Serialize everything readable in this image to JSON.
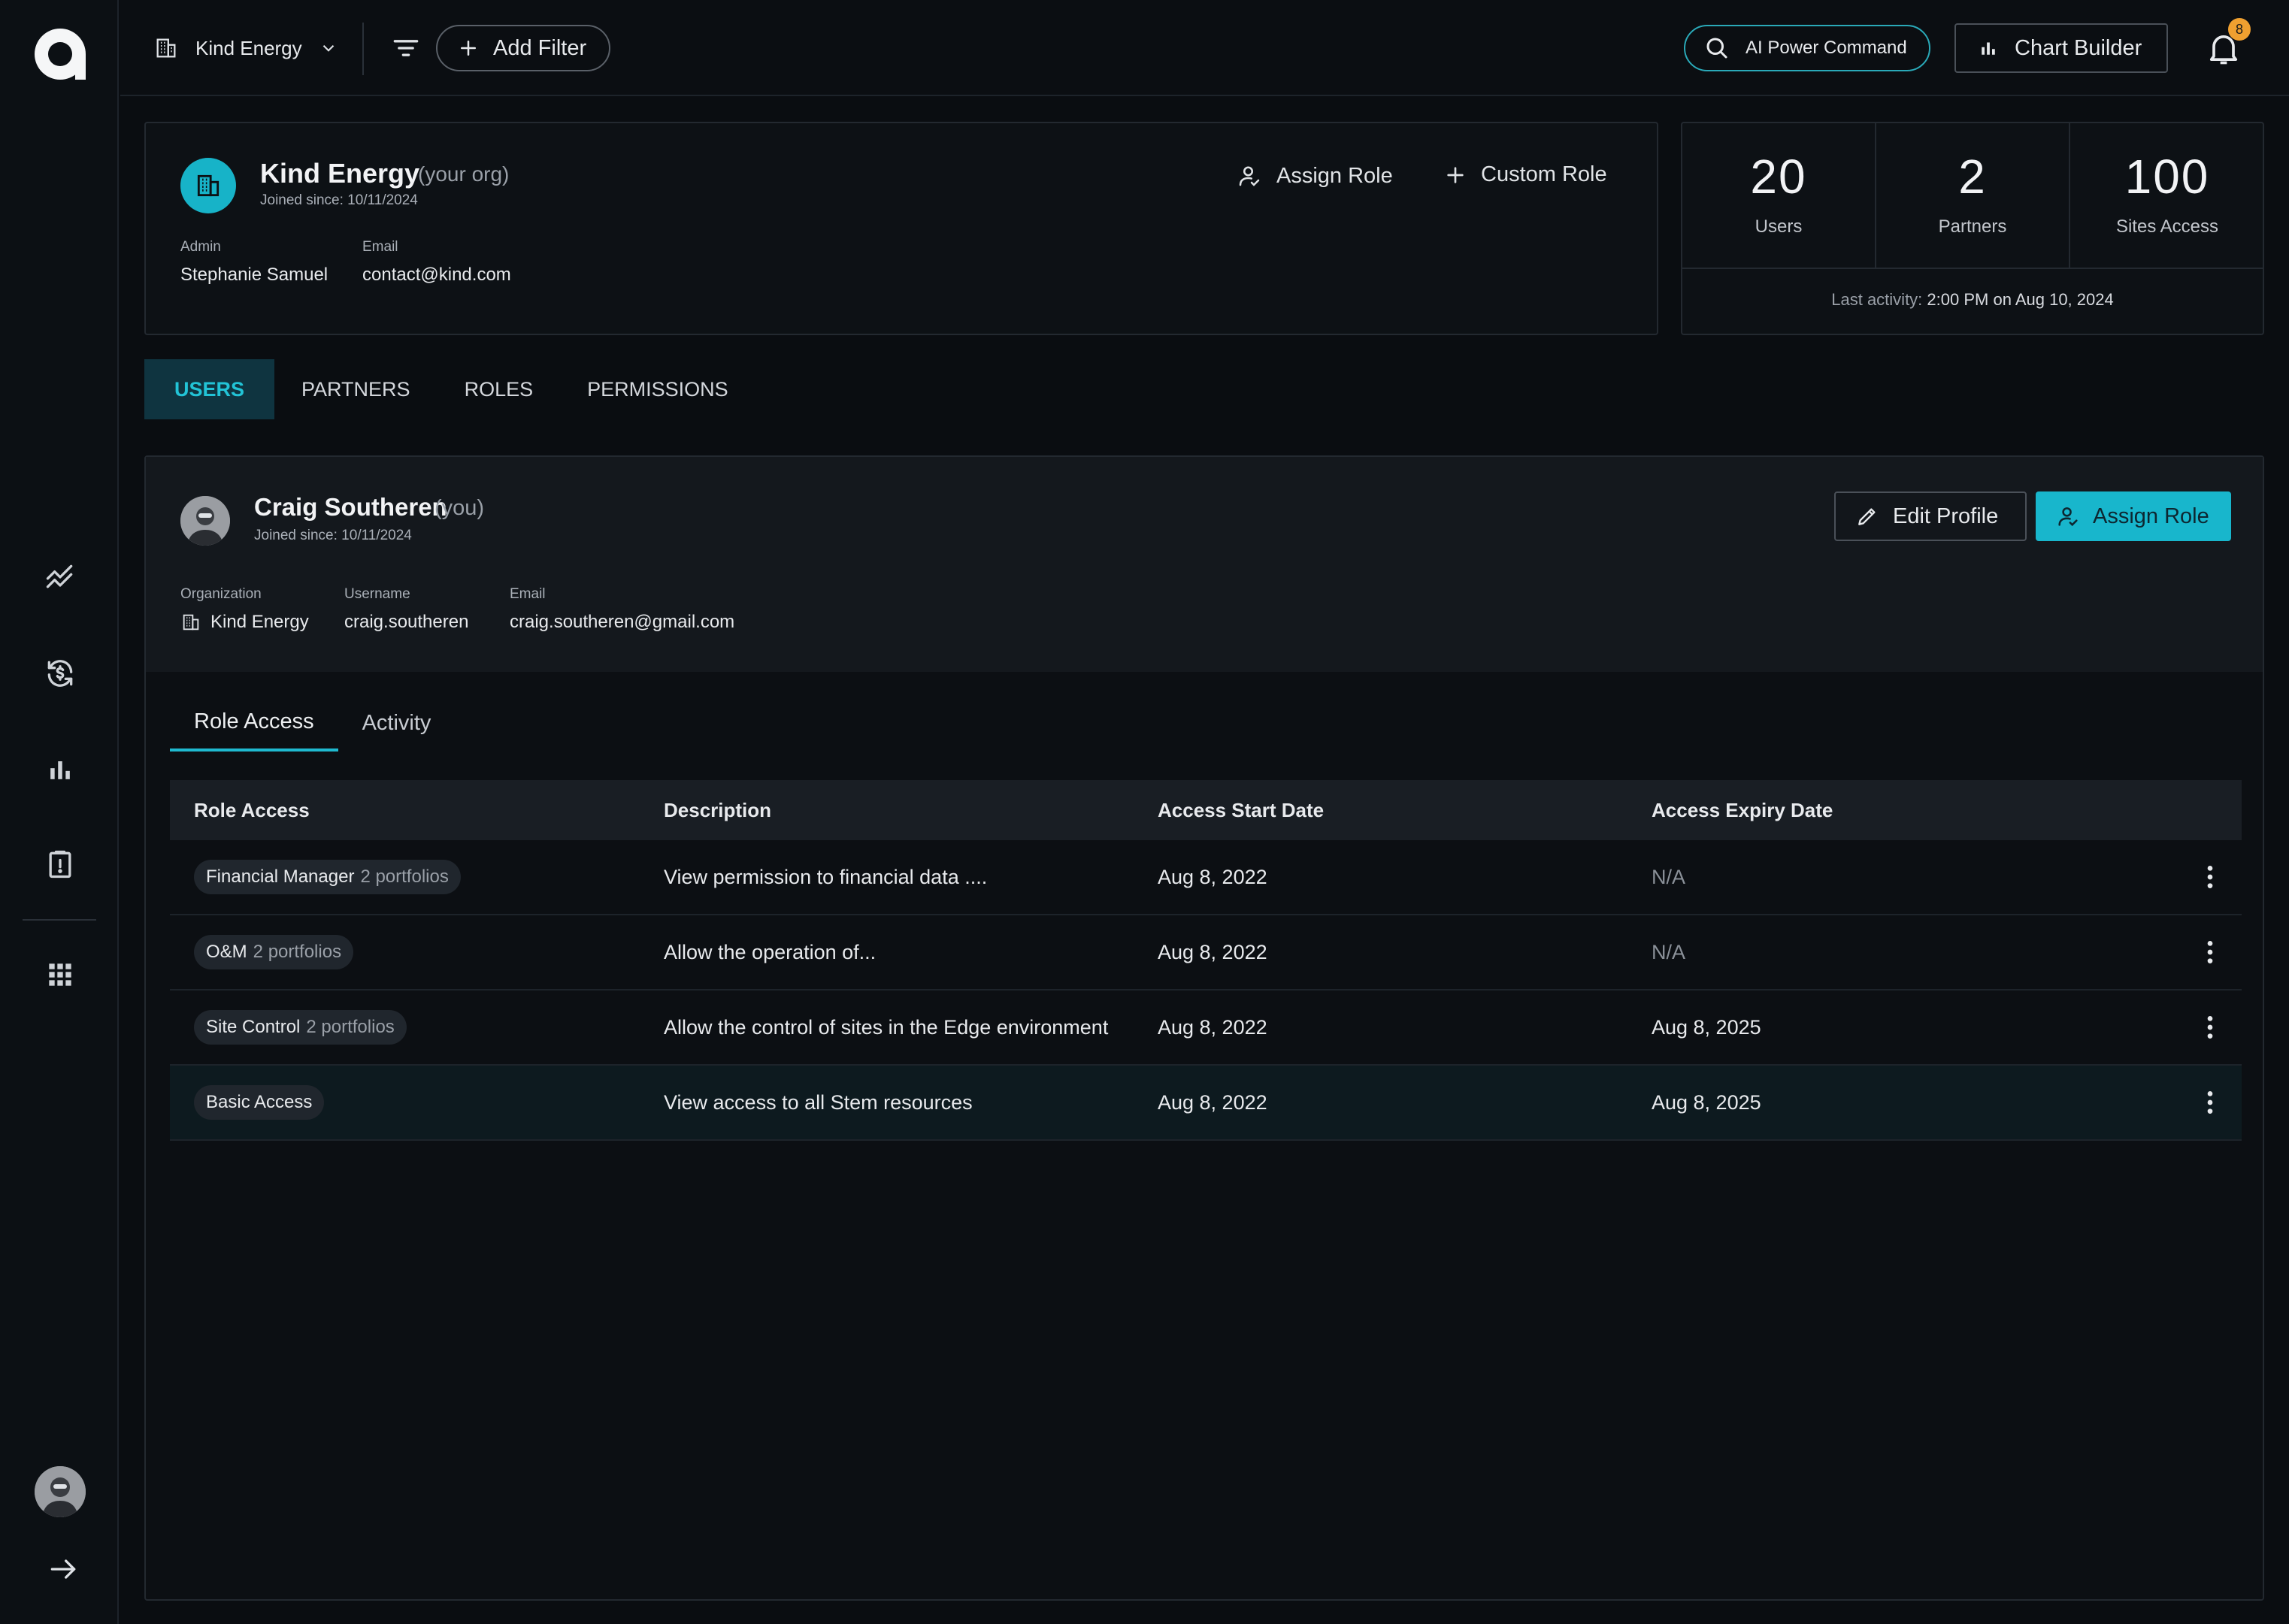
{
  "topbar": {
    "org_name": "Kind Energy",
    "add_filter": "Add Filter",
    "ai_command": "AI Power Command",
    "chart_builder": "Chart Builder",
    "notif_count": "8"
  },
  "org": {
    "name": "Kind Energy",
    "tag": "(your org)",
    "joined": "Joined since: 10/11/2024",
    "admin_label": "Admin",
    "admin_value": "Stephanie Samuel",
    "email_label": "Email",
    "email_value": "contact@kind.com",
    "assign_role": "Assign Role",
    "custom_role": "Custom Role"
  },
  "stats": {
    "users": "20",
    "users_label": "Users",
    "partners": "2",
    "partners_label": "Partners",
    "sites": "100",
    "sites_label": "Sites Access",
    "last_activity_label": "Last activity:",
    "last_activity_value": "2:00 PM on Aug 10, 2024"
  },
  "main_tabs": [
    "USERS",
    "PARTNERS",
    "ROLES",
    "PERMISSIONS"
  ],
  "user": {
    "name": "Craig Southeren",
    "you": "(you)",
    "joined": "Joined since: 10/11/2024",
    "org_label": "Organization",
    "org_value": "Kind Energy",
    "username_label": "Username",
    "username_value": "craig.southeren",
    "email_label": "Email",
    "email_value": "craig.southeren@gmail.com",
    "edit_profile": "Edit Profile",
    "assign_role": "Assign Role"
  },
  "sub_tabs": [
    "Role Access",
    "Activity"
  ],
  "table": {
    "headers": [
      "Role Access",
      "Description",
      "Access Start Date",
      "Access Expiry Date"
    ],
    "rows": [
      {
        "role": "Financial Manager",
        "portfolios": "2 portfolios",
        "desc": "View permission to financial data ....",
        "start": "Aug 8, 2022",
        "expiry": "N/A"
      },
      {
        "role": "O&M",
        "portfolios": "2 portfolios",
        "desc": "Allow the operation of...",
        "start": "Aug 8, 2022",
        "expiry": "N/A"
      },
      {
        "role": "Site Control",
        "portfolios": "2 portfolios",
        "desc": "Allow the control of sites in the Edge environment",
        "start": "Aug 8, 2022",
        "expiry": "Aug 8, 2025"
      },
      {
        "role": "Basic Access",
        "portfolios": "",
        "desc": "View access to all Stem resources",
        "start": "Aug 8, 2022",
        "expiry": "Aug 8, 2025"
      }
    ]
  },
  "colors": {
    "accent": "#18b6cc",
    "background": "#0a0d11",
    "badge": "#f0a030"
  }
}
